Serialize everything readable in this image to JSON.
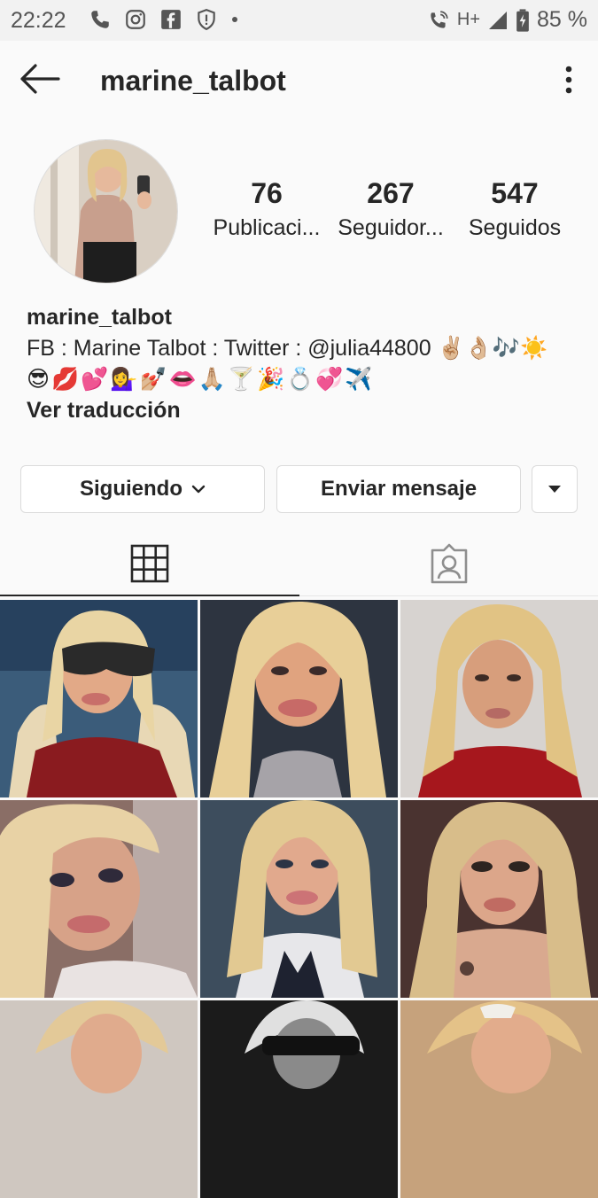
{
  "status_bar": {
    "time": "22:22",
    "network": "H+",
    "battery": "85 %"
  },
  "header": {
    "username": "marine_talbot"
  },
  "profile": {
    "stats": [
      {
        "count": "76",
        "label": "Publicaci..."
      },
      {
        "count": "267",
        "label": "Seguidor..."
      },
      {
        "count": "547",
        "label": "Seguidos"
      }
    ],
    "name": "marine_talbot",
    "bio_line1": "FB : Marine Talbot : Twitter : @julia44800 ✌🏼👌🏼🎶☀️",
    "bio_line2": "😎💋💕💁‍♀️💅🏼👄🙏🏼🍸🎉💍💞✈️",
    "translate_label": "Ver traducción"
  },
  "actions": {
    "following_label": "Siguiendo",
    "message_label": "Enviar mensaje"
  },
  "colors": {
    "text": "#262626",
    "border": "#dbdbdb",
    "background": "#fafafa"
  },
  "icons": {
    "back": "arrow-left-icon",
    "more": "more-vertical-icon",
    "grid": "grid-icon",
    "tagged": "tagged-user-icon"
  }
}
